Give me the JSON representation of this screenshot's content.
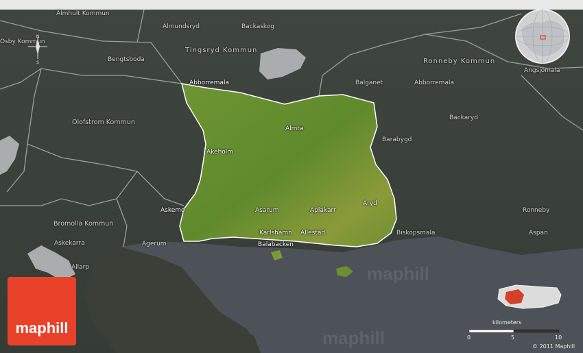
{
  "labels": {
    "almhult": "Älmhult Kommun",
    "osby": "Osby Kommun",
    "almundsryd": "Almundsryd",
    "backaskog": "Backaskog",
    "tingsryd": "Tingsryd Kommun",
    "bengtsboda": "Bengtsboda",
    "ronneby_kommun": "Ronneby Kommun",
    "angsjomala": "Angsjomala",
    "abborremala_w": "Abborremala",
    "balganet": "Balganet",
    "abborremala_e": "Abborremala",
    "olofstrom": "Olofstrom Kommun",
    "backaryd": "Backaryd",
    "almta": "Almta",
    "barabygd": "Barabygd",
    "akeholm": "Akeholm",
    "askemo": "Askemo",
    "asarum": "Asarum",
    "aplakarr": "Aplakarr",
    "aryd": "Aryd",
    "ronneby": "Ronneby",
    "bromolla": "Bromolla Kommun",
    "karlshamn": "Karlshamn",
    "allestad": "Allestad",
    "biskopsmala": "Biskopsmala",
    "askekarra": "Askekarra",
    "agerum": "Agerum",
    "aspan": "Aspan",
    "balabacken": "Balabacken",
    "allarp": "Allarp"
  },
  "compass": {
    "north": "N",
    "south": "S"
  },
  "scale": {
    "title": "kilometers",
    "ticks": [
      "0",
      "5",
      "10"
    ]
  },
  "brand": {
    "logo_text": "maphill",
    "watermark": "maphill",
    "copyright": "© 2011 Maphill"
  },
  "colors": {
    "highlight": "#6f9a33",
    "sea": "#4c5257",
    "land": "#3b4139",
    "logo": "#e8432a",
    "border": "#ffffff"
  }
}
